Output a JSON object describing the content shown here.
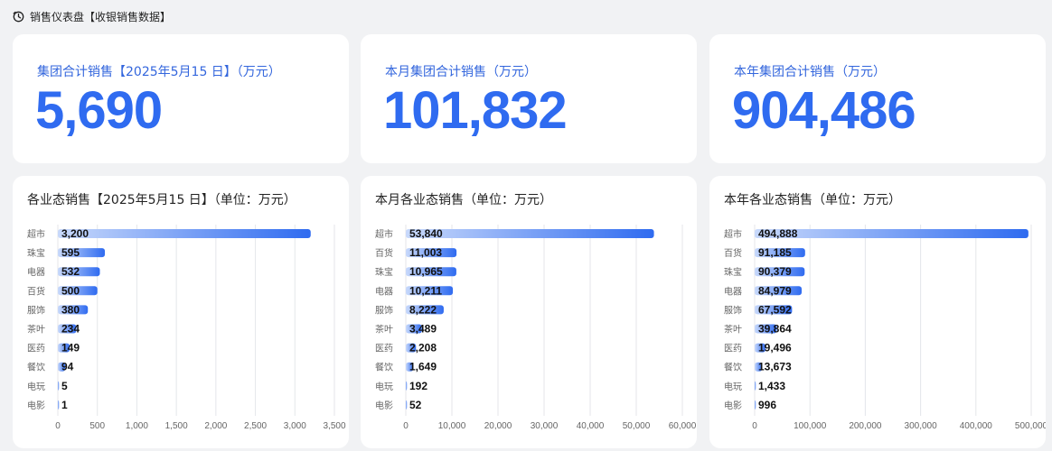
{
  "header": {
    "icon": "clock-icon",
    "title": "销售仪表盘【收银销售数据】"
  },
  "kpis": [
    {
      "label": "集团合计销售【2025年5月15 日】（万元）",
      "value": "5,690"
    },
    {
      "label": "本月集团合计销售（万元）",
      "value": "101,832"
    },
    {
      "label": "本年集团合计销售（万元）",
      "value": "904,486"
    }
  ],
  "colors": {
    "accent": "#2f6bf0",
    "bar_start": "#c8d9fb",
    "bar_end": "#2f6bf0"
  },
  "chart_data": [
    {
      "type": "bar",
      "orientation": "horizontal",
      "title": "各业态销售【2025年5月15 日】（单位：万元）",
      "categories": [
        "超市",
        "珠宝",
        "电器",
        "百货",
        "服饰",
        "茶叶",
        "医药",
        "餐饮",
        "电玩",
        "电影"
      ],
      "values": [
        3200,
        595,
        532,
        500,
        380,
        234,
        149,
        94,
        5,
        1
      ],
      "value_labels": [
        "3,200",
        "595",
        "532",
        "500",
        "380",
        "234",
        "149",
        "94",
        "5",
        "1"
      ],
      "xlim": [
        0,
        3500
      ],
      "xticks": [
        0,
        500,
        1000,
        1500,
        2000,
        2500,
        3000,
        3500
      ],
      "xtick_labels": [
        "0",
        "500",
        "1,000",
        "1,500",
        "2,000",
        "2,500",
        "3,000",
        "3,500"
      ],
      "grid": true
    },
    {
      "type": "bar",
      "orientation": "horizontal",
      "title": "本月各业态销售（单位：万元）",
      "categories": [
        "超市",
        "百货",
        "珠宝",
        "电器",
        "服饰",
        "茶叶",
        "医药",
        "餐饮",
        "电玩",
        "电影"
      ],
      "values": [
        53840,
        11003,
        10965,
        10211,
        8222,
        3489,
        2208,
        1649,
        192,
        52
      ],
      "value_labels": [
        "53,840",
        "11,003",
        "10,965",
        "10,211",
        "8,222",
        "3,489",
        "2,208",
        "1,649",
        "192",
        "52"
      ],
      "xlim": [
        0,
        60000
      ],
      "xticks": [
        0,
        10000,
        20000,
        30000,
        40000,
        50000,
        60000
      ],
      "xtick_labels": [
        "0",
        "10,000",
        "20,000",
        "30,000",
        "40,000",
        "50,000",
        "60,000"
      ],
      "grid": true
    },
    {
      "type": "bar",
      "orientation": "horizontal",
      "title": "本年各业态销售（单位：万元）",
      "categories": [
        "超市",
        "百货",
        "珠宝",
        "电器",
        "服饰",
        "茶叶",
        "医药",
        "餐饮",
        "电玩",
        "电影"
      ],
      "values": [
        494888,
        91185,
        90379,
        84979,
        67592,
        39864,
        19496,
        13673,
        1433,
        996
      ],
      "value_labels": [
        "494,888",
        "91,185",
        "90,379",
        "84,979",
        "67,592",
        "39,864",
        "19,496",
        "13,673",
        "1,433",
        "996"
      ],
      "xlim": [
        0,
        500000
      ],
      "xticks": [
        0,
        100000,
        200000,
        300000,
        400000,
        500000
      ],
      "xtick_labels": [
        "0",
        "100,000",
        "200,000",
        "300,000",
        "400,000",
        "500,000"
      ],
      "grid": true
    }
  ]
}
